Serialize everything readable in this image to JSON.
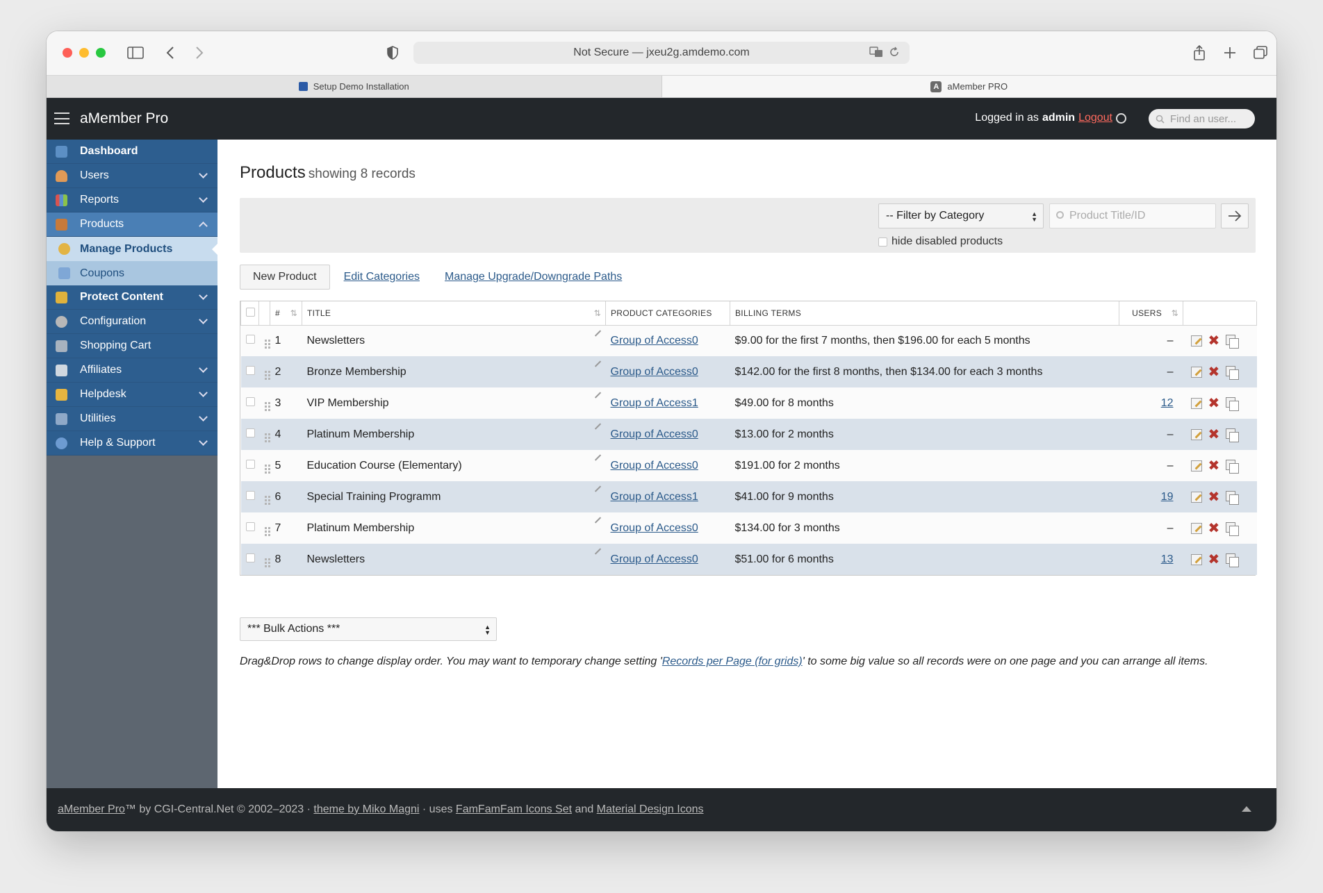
{
  "browser": {
    "url": "Not Secure — jxeu2g.amdemo.com",
    "tabs": [
      {
        "label": "Setup Demo Installation"
      },
      {
        "label": "aMember PRO"
      }
    ]
  },
  "header": {
    "brand": "aMember Pro",
    "logged_in_prefix": "Logged in as",
    "username": "admin",
    "logout": "Logout",
    "find_user_placeholder": "Find an user..."
  },
  "sidebar": {
    "items": [
      {
        "label": "Dashboard",
        "icon": "dashboard-icon"
      },
      {
        "label": "Users",
        "icon": "users-icon"
      },
      {
        "label": "Reports",
        "icon": "reports-icon"
      },
      {
        "label": "Products",
        "icon": "products-icon"
      },
      {
        "label": "Protect Content",
        "icon": "lock-icon"
      },
      {
        "label": "Configuration",
        "icon": "gear-icon"
      },
      {
        "label": "Shopping Cart",
        "icon": "cart-icon"
      },
      {
        "label": "Affiliates",
        "icon": "affiliates-icon"
      },
      {
        "label": "Helpdesk",
        "icon": "helpdesk-icon"
      },
      {
        "label": "Utilities",
        "icon": "wrench-icon"
      },
      {
        "label": "Help & Support",
        "icon": "help-icon"
      }
    ],
    "sub_items": [
      {
        "label": "Manage Products"
      },
      {
        "label": "Coupons"
      }
    ]
  },
  "main": {
    "title": "Products",
    "subtitle": "showing 8 records",
    "filter": {
      "category_select": "-- Filter by Category",
      "search_placeholder": "Product Title/ID",
      "hide_disabled": "hide disabled products"
    },
    "actions": {
      "new_product": "New Product",
      "edit_categories": "Edit Categories",
      "manage_paths": "Manage Upgrade/Downgrade Paths"
    },
    "columns": {
      "num": "#",
      "title": "TITLE",
      "categories": "PRODUCT CATEGORIES",
      "billing": "BILLING TERMS",
      "users": "USERS"
    },
    "rows": [
      {
        "num": "1",
        "title": "Newsletters",
        "category": "Group of Access0",
        "billing": "$9.00 for the first 7 months, then $196.00 for each 5 months",
        "users": "–"
      },
      {
        "num": "2",
        "title": "Bronze Membership",
        "category": "Group of Access0",
        "billing": "$142.00 for the first 8 months, then $134.00 for each 3 months",
        "users": "–"
      },
      {
        "num": "3",
        "title": "VIP Membership",
        "category": "Group of Access1",
        "billing": "$49.00 for 8 months",
        "users": "12"
      },
      {
        "num": "4",
        "title": "Platinum Membership",
        "category": "Group of Access0",
        "billing": "$13.00 for 2 months",
        "users": "–"
      },
      {
        "num": "5",
        "title": "Education Course (Elementary)",
        "category": "Group of Access0",
        "billing": "$191.00 for 2 months",
        "users": "–"
      },
      {
        "num": "6",
        "title": "Special Training Programm",
        "category": "Group of Access1",
        "billing": "$41.00 for 9 months",
        "users": "19"
      },
      {
        "num": "7",
        "title": "Platinum Membership",
        "category": "Group of Access0",
        "billing": "$134.00 for 3 months",
        "users": "–"
      },
      {
        "num": "8",
        "title": "Newsletters",
        "category": "Group of Access0",
        "billing": "$51.00 for 6 months",
        "users": "13"
      }
    ],
    "bulk_actions": "*** Bulk Actions ***",
    "hint_before": "Drag&Drop rows to change display order. You may want to temporary change setting '",
    "hint_link": "Records per Page (for grids)",
    "hint_after": "' to some big value so all records were on one page and you can arrange all items."
  },
  "footer": {
    "brand_link": "aMember Pro",
    "text1": "™ by CGI-Central.Net © 2002–2023 · ",
    "theme_link": "theme by Miko Magni",
    "text2": " · uses ",
    "famfam_link": "FamFamFam Icons Set",
    "text3": " and ",
    "material_link": "Material Design Icons"
  },
  "colors": {
    "sidebar_menu": "#2d5e8f",
    "header_bg": "#23272b",
    "row_alt": "#d9e1ea",
    "link": "#2b5a8a",
    "logout": "#ff6a5e"
  }
}
